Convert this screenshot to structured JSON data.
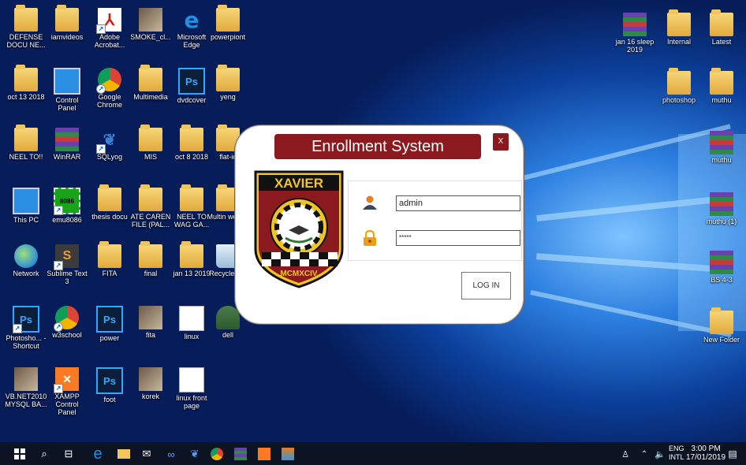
{
  "desktop": {
    "icons_left": [
      {
        "label": "DEFENSE DOCU NE...",
        "icon": "folder-icon"
      },
      {
        "label": "iamvideos",
        "icon": "folder-icon"
      },
      {
        "label": "Adobe Acrobat...",
        "icon": "acrobat-icon"
      },
      {
        "label": "SMOKE_cl...",
        "icon": "image-icon"
      },
      {
        "label": "Microsoft Edge",
        "icon": "edge-icon"
      },
      {
        "label": "powerpiont",
        "icon": "folder-icon"
      },
      {
        "label": "oct 13 2018",
        "icon": "folder-icon"
      },
      {
        "label": "Control Panel",
        "icon": "control-panel-icon"
      },
      {
        "label": "Google Chrome",
        "icon": "chrome-icon"
      },
      {
        "label": "Multimedia",
        "icon": "folder-icon"
      },
      {
        "label": "dvdcover",
        "icon": "photoshop-icon"
      },
      {
        "label": "yeng",
        "icon": "folder-icon"
      },
      {
        "label": "NEEL TO!!",
        "icon": "folder-icon"
      },
      {
        "label": "WinRAR",
        "icon": "winrar-icon"
      },
      {
        "label": "SQLyog",
        "icon": "sqlyog-icon"
      },
      {
        "label": "MIS",
        "icon": "folder-icon"
      },
      {
        "label": "oct 8 2018",
        "icon": "folder-icon"
      },
      {
        "label": "flat-ic",
        "icon": "folder-icon"
      },
      {
        "label": "This PC",
        "icon": "computer-icon"
      },
      {
        "label": "emu8086",
        "icon": "chip-icon"
      },
      {
        "label": "thesis docu",
        "icon": "folder-icon"
      },
      {
        "label": "ATE CAREN FILE (PAL...",
        "icon": "folder-icon"
      },
      {
        "label": "NEEL TO WAG GA...",
        "icon": "folder-icon"
      },
      {
        "label": "Multin web m",
        "icon": "folder-icon"
      },
      {
        "label": "Network",
        "icon": "network-icon"
      },
      {
        "label": "Sublime Text 3",
        "icon": "sublime-icon"
      },
      {
        "label": "FITA",
        "icon": "folder-icon"
      },
      {
        "label": "final",
        "icon": "folder-icon"
      },
      {
        "label": "jan 13 2019",
        "icon": "folder-icon"
      },
      {
        "label": "Recycle Bin",
        "icon": "recycle-bin-icon"
      },
      {
        "label": "Photosho... - Shortcut",
        "icon": "photoshop-icon"
      },
      {
        "label": "w3school",
        "icon": "chrome-icon"
      },
      {
        "label": "power",
        "icon": "photoshop-icon"
      },
      {
        "label": "fita",
        "icon": "image-icon"
      },
      {
        "label": "linux",
        "icon": "document-icon"
      },
      {
        "label": "dell",
        "icon": "user-icon"
      },
      {
        "label": "VB.NET2010 MYSQL BA...",
        "icon": "image-icon"
      },
      {
        "label": "XAMPP Control Panel",
        "icon": "xampp-icon"
      },
      {
        "label": "foot",
        "icon": "photoshop-icon"
      },
      {
        "label": "korek",
        "icon": "image-icon"
      },
      {
        "label": "linux front page",
        "icon": "document-icon"
      }
    ],
    "icons_right": [
      {
        "label": "jan 16 sleep 2019",
        "icon": "winrar-icon"
      },
      {
        "label": "Internal",
        "icon": "folder-icon"
      },
      {
        "label": "Latest",
        "icon": "folder-icon"
      },
      {
        "label": "photoshop",
        "icon": "folder-icon"
      },
      {
        "label": "muthu",
        "icon": "folder-icon"
      },
      {
        "label": "muthu",
        "icon": "winrar-icon"
      },
      {
        "label": "muthu (1)",
        "icon": "winrar-icon"
      },
      {
        "label": "BS 4-3",
        "icon": "winrar-icon"
      },
      {
        "label": "New Folder",
        "icon": "folder-icon"
      }
    ]
  },
  "dialog": {
    "title": "Enrollment System",
    "close_label": "X",
    "logo_top_text": "XAVIER",
    "logo_bottom_text": "MCMXCIV",
    "username_value": "admin",
    "password_value": "*****",
    "login_label": "LOG IN"
  },
  "taskbar": {
    "lang_top": "ENG",
    "lang_bottom": "INTL",
    "time": "3:00 PM",
    "date": "17/01/2019"
  }
}
